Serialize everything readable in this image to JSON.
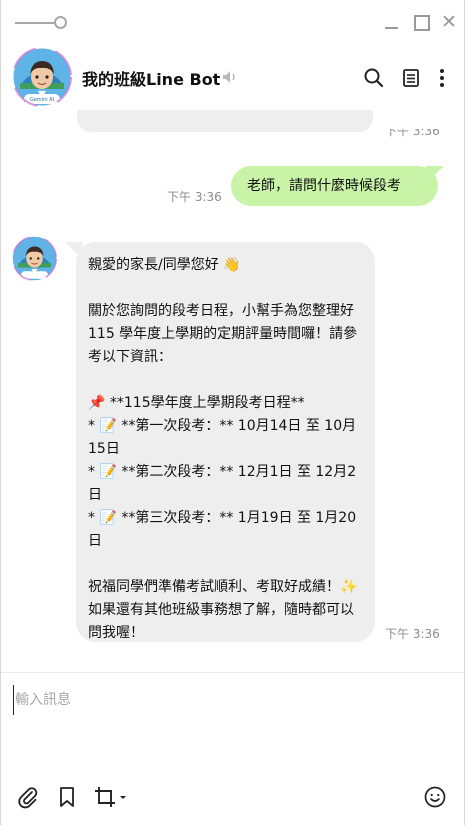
{
  "header": {
    "title": "我的班級Line Bot",
    "avatar_badge": "Gemini AI"
  },
  "icons": {
    "mute": "speaker-muted-icon",
    "search": "search-icon",
    "notes": "notes-icon",
    "more": "more-vertical-icon",
    "attach": "paperclip-icon",
    "bookmark": "bookmark-icon",
    "crop": "crop-icon",
    "emoji": "smiley-icon"
  },
  "messages": {
    "previous_time": "下午 3:36",
    "me": {
      "text": "老師，請問什麼時候段考",
      "time": "下午 3:36"
    },
    "bot": {
      "time": "下午 3:36",
      "lines": [
        "親愛的家長/同學您好 👋",
        "",
        "關於您詢問的段考日程，小幫手為您整理好 115 學年度上學期的定期評量時間囉！請參考以下資訊：",
        "",
        "📌 **115學年度上學期段考日程**",
        "* 📝 **第一次段考：** 10月14日 至 10月15日",
        "* 📝 **第二次段考：** 12月1日 至 12月2日",
        "* 📝 **第三次段考：** 1月19日 至 1月20日",
        "",
        "祝福同學們準備考試順利、考取好成績！✨ 如果還有其他班級事務想了解，隨時都可以問我喔！"
      ]
    }
  },
  "input": {
    "placeholder": "輸入訊息",
    "value": ""
  },
  "colors": {
    "my_bubble": "#c9f4a7",
    "bot_bubble": "#eeeeee",
    "timestamp": "#8c8c8c"
  }
}
